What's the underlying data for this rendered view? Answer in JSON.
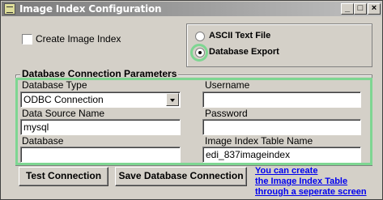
{
  "window": {
    "title": "Image Index Configuration",
    "min_glyph": "_",
    "max_glyph": "□",
    "close_glyph": "×"
  },
  "options": {
    "create_image_index_label": "Create Image Index",
    "create_image_index_checked": false,
    "ascii_text_file_label": "ASCII Text File",
    "database_export_label": "Database Export",
    "selected": "Database Export"
  },
  "db_params": {
    "group_title": "Database Connection Parameters",
    "database_type_label": "Database Type",
    "database_type_value": "ODBC Connection",
    "data_source_name_label": "Data Source Name",
    "data_source_name_value": "mysql",
    "database_label": "Database",
    "database_value": "",
    "username_label": "Username",
    "username_value": "",
    "password_label": "Password",
    "password_value": "",
    "image_index_table_label": "Image Index Table Name",
    "image_index_table_value": "edi_837imageindex"
  },
  "actions": {
    "test_connection_label": "Test Connection",
    "save_connection_label": "Save Database Connection",
    "create_table_link_line1": "You can create",
    "create_table_link_line2": "the Image Index Table",
    "create_table_link_line3": "through a seperate screen"
  },
  "colors": {
    "highlight": "#7ed692",
    "link": "#0000ee",
    "dialog_bg": "#d4d0c8"
  }
}
